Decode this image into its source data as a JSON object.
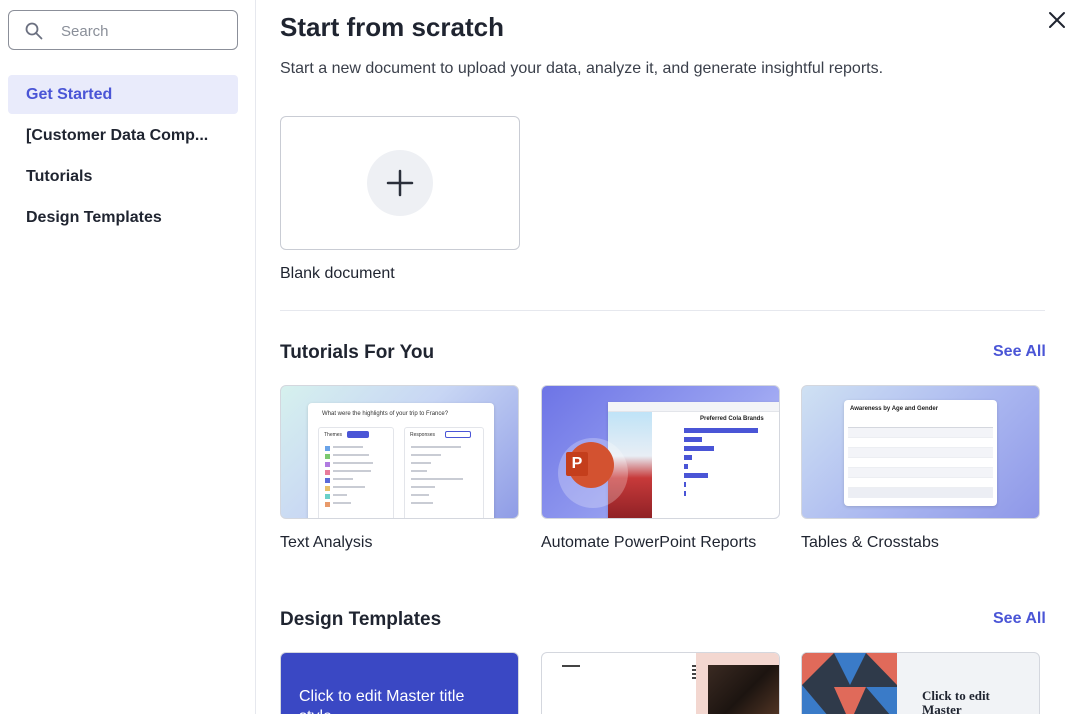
{
  "sidebar": {
    "search_placeholder": "Search",
    "items": [
      {
        "label": "Get Started",
        "active": true
      },
      {
        "label": "[Customer Data Comp...",
        "active": false
      },
      {
        "label": "Tutorials",
        "active": false
      },
      {
        "label": "Design Templates",
        "active": false
      }
    ]
  },
  "main": {
    "title": "Start from scratch",
    "subtitle": "Start a new document to upload your data, analyze it, and generate insightful reports.",
    "blank_label": "Blank document",
    "tutorials": {
      "title": "Tutorials For You",
      "see_all": "See All",
      "items": [
        {
          "label": "Text Analysis",
          "thumb_title": "What were the highlights of your trip to France?",
          "col1": "Themes",
          "col2": "Responses"
        },
        {
          "label": "Automate PowerPoint Reports",
          "thumb_title": "Preferred Cola Brands"
        },
        {
          "label": "Tables & Crosstabs",
          "thumb_title": "Awareness by Age and Gender"
        }
      ]
    },
    "templates": {
      "title": "Design Templates",
      "see_all": "See All",
      "items": [
        {
          "text": "Click to edit Master title style"
        },
        {
          "text": ""
        },
        {
          "text": "Click to edit Master"
        }
      ]
    }
  },
  "colors": {
    "accent": "#4a55d6",
    "active_bg": "#e9ebfb",
    "text": "#1f2430"
  },
  "icons": {
    "search": "search-icon",
    "close": "close-icon",
    "plus": "plus-icon",
    "powerpoint": "powerpoint-icon"
  }
}
